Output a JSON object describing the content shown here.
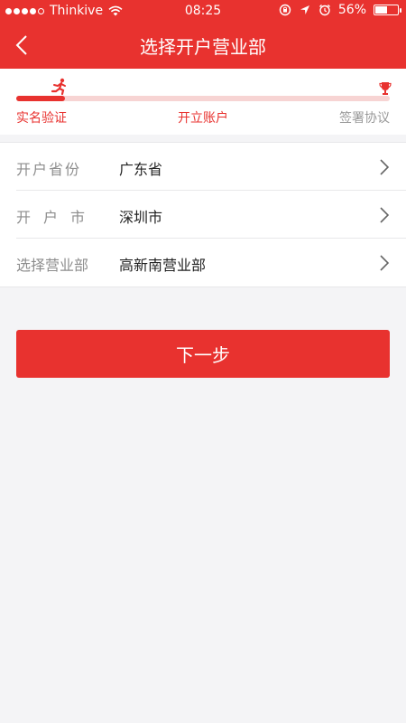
{
  "status_bar": {
    "carrier": "Thinkive",
    "time": "08:25",
    "battery_percent_text": "56%",
    "battery_level": 0.56
  },
  "nav": {
    "title": "选择开户营业部",
    "back_icon": "chevron-left-icon"
  },
  "progress": {
    "steps": [
      {
        "label": "实名验证",
        "state": "done"
      },
      {
        "label": "开立账户",
        "state": "current"
      },
      {
        "label": "签署协议",
        "state": "pending"
      }
    ],
    "fraction_complete": 0.13
  },
  "form": {
    "rows": [
      {
        "label": "开户省份",
        "value": "广东省"
      },
      {
        "label": "开户市",
        "value": "深圳市"
      },
      {
        "label": "选择营业部",
        "value": "高新南营业部"
      }
    ]
  },
  "actions": {
    "next_label": "下一步"
  },
  "colors": {
    "accent": "#e8322f",
    "background": "#f4f4f6",
    "track": "#f7d4d3"
  }
}
